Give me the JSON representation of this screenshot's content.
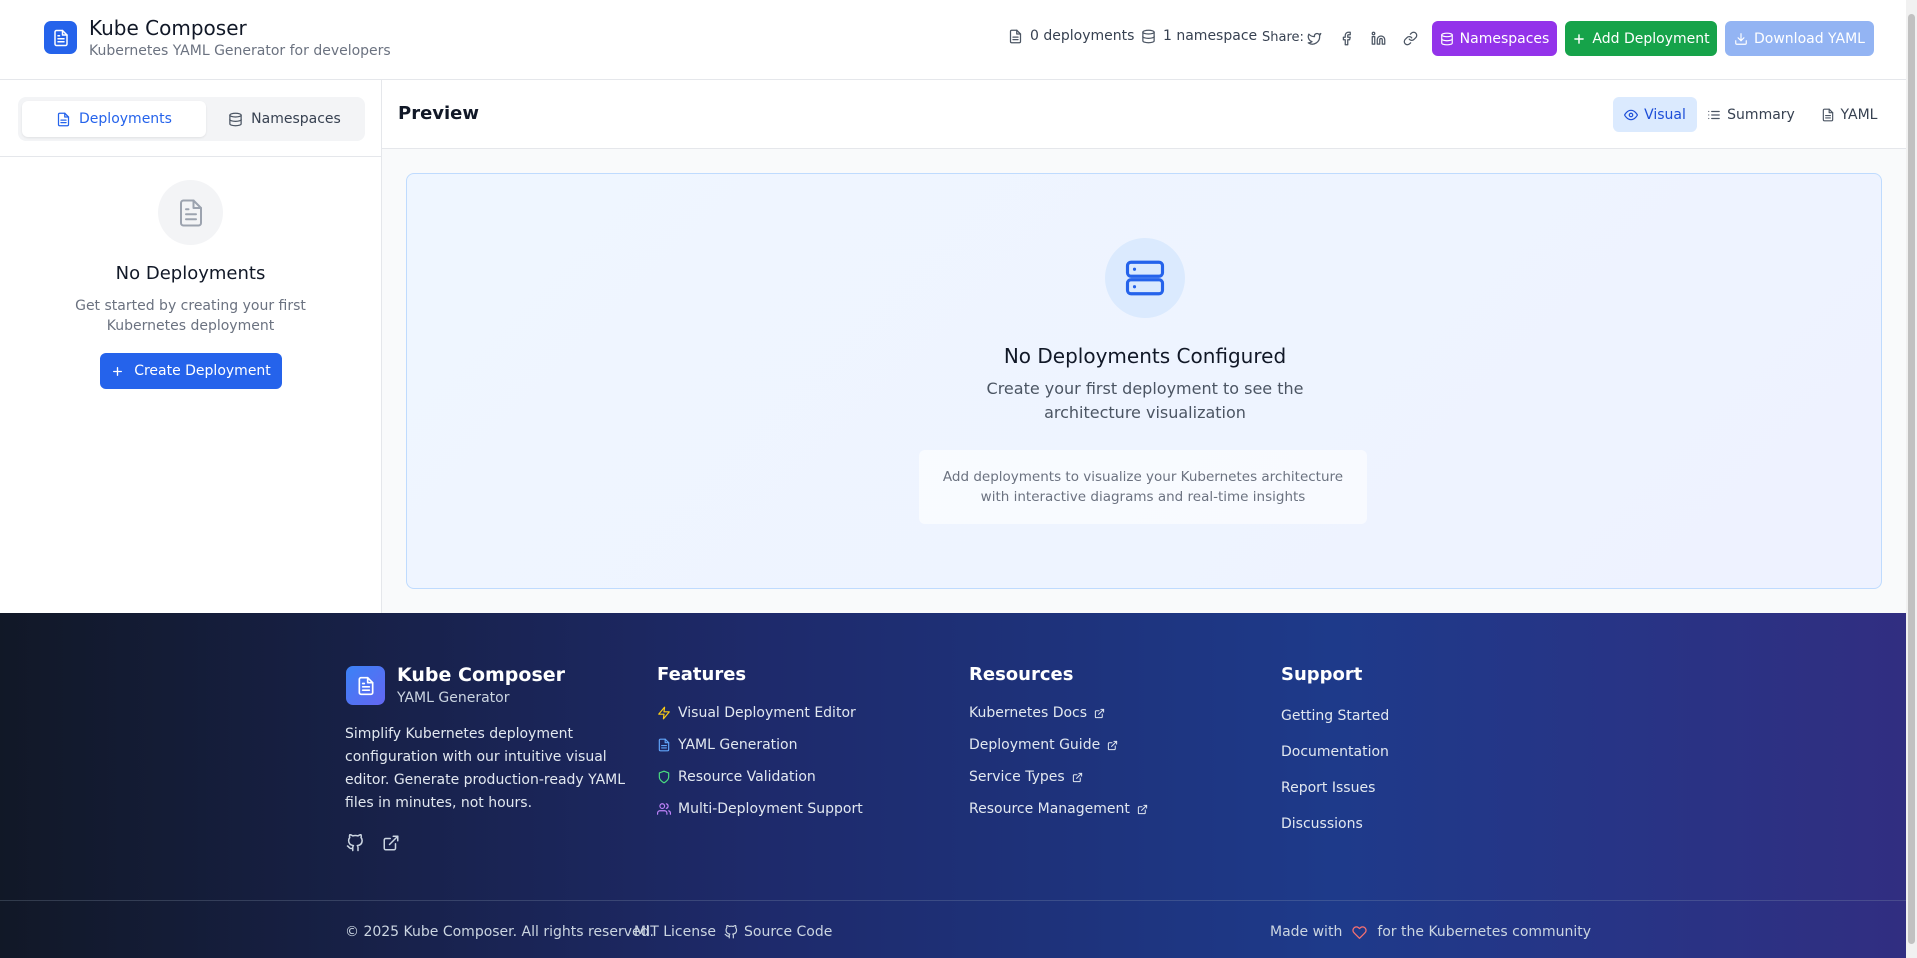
{
  "header": {
    "title": "Kube Composer",
    "subtitle": "Kubernetes YAML Generator for developers",
    "deployments_count": "0 deployments",
    "namespaces_count": "1 namespace",
    "share_label": "Share:",
    "namespaces_button": "Namespaces",
    "add_deployment_button": "Add Deployment",
    "download_yaml_button": "Download YAML"
  },
  "sidebar": {
    "tabs": [
      {
        "label": "Deployments",
        "icon": "document-icon",
        "active": true
      },
      {
        "label": "Namespaces",
        "icon": "database-icon",
        "active": false
      }
    ],
    "empty_title": "No Deployments",
    "empty_description": "Get started by creating your first Kubernetes deployment",
    "create_button": "Create Deployment"
  },
  "preview": {
    "title": "Preview",
    "view_tabs": [
      {
        "label": "Visual",
        "icon": "eye-icon",
        "active": true
      },
      {
        "label": "Summary",
        "icon": "list-icon",
        "active": false
      },
      {
        "label": "YAML",
        "icon": "document-icon",
        "active": false
      }
    ],
    "empty_title": "No Deployments Configured",
    "empty_description": "Create your first deployment to see the architecture visualization",
    "note": "Add deployments to visualize your Kubernetes architecture with interactive diagrams and real-time insights"
  },
  "footer": {
    "brand": "Kube Composer",
    "brand_sub": "YAML Generator",
    "description": "Simplify Kubernetes deployment configuration with our intuitive visual editor. Generate production-ready YAML files in minutes, not hours.",
    "columns": [
      {
        "title": "Features",
        "items": [
          {
            "label": "Visual Deployment Editor",
            "icon": "lightning-icon"
          },
          {
            "label": "YAML Generation",
            "icon": "document-icon"
          },
          {
            "label": "Resource Validation",
            "icon": "shield-icon"
          },
          {
            "label": "Multi-Deployment Support",
            "icon": "users-icon"
          }
        ]
      },
      {
        "title": "Resources",
        "items": [
          {
            "label": "Kubernetes Docs",
            "icon": "external-link-icon"
          },
          {
            "label": "Deployment Guide",
            "icon": "external-link-icon"
          },
          {
            "label": "Service Types",
            "icon": "external-link-icon"
          },
          {
            "label": "Resource Management",
            "icon": "external-link-icon"
          }
        ]
      },
      {
        "title": "Support",
        "items": [
          {
            "label": "Getting Started"
          },
          {
            "label": "Documentation"
          },
          {
            "label": "Report Issues"
          },
          {
            "label": "Discussions"
          }
        ]
      }
    ],
    "copyright": "© 2025 Kube Composer. All rights reserved.",
    "license": "MIT License",
    "source_code": "Source Code",
    "made_with": "Made with",
    "made_for": "for the Kubernetes community"
  },
  "colors": {
    "primary_blue": "#2563eb",
    "purple": "#9333ea",
    "green": "#16a34a",
    "disabled_blue": "#93b4f3",
    "heart": "#f87171"
  }
}
